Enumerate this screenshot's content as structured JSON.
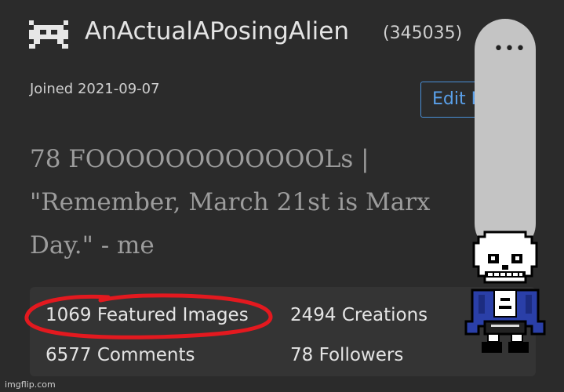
{
  "profile": {
    "avatar_icon": "space-invader-icon",
    "username": "AnActualAPosingAlien",
    "user_id": "(345035)",
    "joined": "Joined 2021-09-07",
    "edit_button_label": "Edit P",
    "bio_lines": [
      "78 FOOOOOOOOOOOOLs |",
      "\"Remember, March 21st is Marx",
      "Day.\" - me"
    ]
  },
  "stats": {
    "featured_images": "1069 Featured Images",
    "creations": "2494 Creations",
    "comments": "6577 Comments",
    "followers": "78 Followers"
  },
  "overlay": {
    "more_menu_icon": "more-horizontal-icon",
    "more_menu_glyph": "•••",
    "sprite_icon": "sans-skeleton-sprite-icon"
  },
  "watermark": "imgflip.com",
  "colors": {
    "background": "#2b2b2b",
    "panel": "#343434",
    "accent_blue": "#4a8fd6",
    "annotation_red": "#e3191f",
    "overlay_gray": "#c4c4c4"
  }
}
